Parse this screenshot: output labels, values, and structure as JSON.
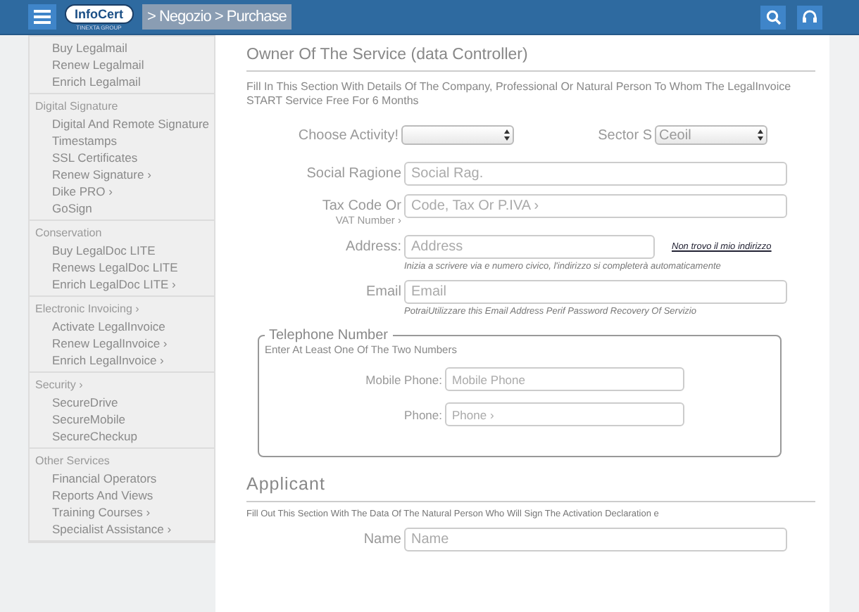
{
  "header": {
    "logo": "InfoCert",
    "logo_sub": "TINEXTA GROUP",
    "breadcrumb": "> Negozio > Purchase"
  },
  "sidebar": {
    "groups": [
      {
        "items": [
          "Buy Legalmail",
          "Renew Legalmail",
          "Enrich Legalmail"
        ]
      },
      {
        "heading": "Digital Signature",
        "items": [
          "Digital And Remote Signature",
          "Timestamps",
          "SSL Certificates",
          "Renew Signature ›",
          "Dike PRO ›",
          "GoSign"
        ]
      },
      {
        "heading": "Conservation",
        "items": [
          "Buy LegalDoc LITE",
          "Renews LegalDoc LITE",
          "Enrich LegalDoc LITE ›"
        ]
      },
      {
        "heading": "Electronic Invoicing ›",
        "items": [
          "Activate LegalInvoice",
          "Renew LegalInvoice ›",
          "Enrich LegalInvoice ›"
        ]
      },
      {
        "heading": "Security ›",
        "items": [
          "SecureDrive",
          "SecureMobile",
          "SecureCheckup"
        ]
      },
      {
        "heading": "Other Services",
        "items": [
          "Financial Operators",
          "Reports And Views",
          "Training Courses ›",
          "Specialist Assistance ›"
        ]
      }
    ]
  },
  "owner": {
    "title": "Owner Of The Service (data Controller)",
    "description": "Fill In This Section With Details Of The Company, Professional Or Natural Person To Whom The LegalInvoice START Service Free For 6 Months",
    "activity": {
      "label": "Choose Activity!"
    },
    "sector": {
      "label": "Sector S",
      "value": "Ceoil"
    },
    "fields": [
      {
        "label": "Social Ragione",
        "placeholder": "Social Rag."
      },
      {
        "label": "Tax Code Or",
        "label_2": "VAT Number ›",
        "placeholder": "Code, Tax Or P.IVA ›"
      },
      {
        "label": "Address:",
        "placeholder": "Address",
        "link": "Non trovo il mio indirizzo",
        "hint": "Inizia a scrivere via e numero civico, l'indirizzo si completerà automaticamente"
      },
      {
        "label": "Email",
        "placeholder": "Email",
        "hint": "PotraiUtilizzare this Email Address Perif Password Recovery Of Servizio"
      }
    ]
  },
  "telephone": {
    "legend": "Telephone Number",
    "note": "Enter At Least One Of The Two Numbers",
    "fields": [
      {
        "label": "Mobile Phone:",
        "placeholder": "Mobile Phone"
      },
      {
        "label": "Phone:",
        "placeholder": "Phone ›"
      }
    ]
  },
  "applicant": {
    "title": "Applicant",
    "description": "Fill Out This Section With The Data Of The Natural Person Who Will Sign The Activation Declaration e",
    "fields": [
      {
        "label": "Name",
        "placeholder": "Name"
      }
    ]
  }
}
